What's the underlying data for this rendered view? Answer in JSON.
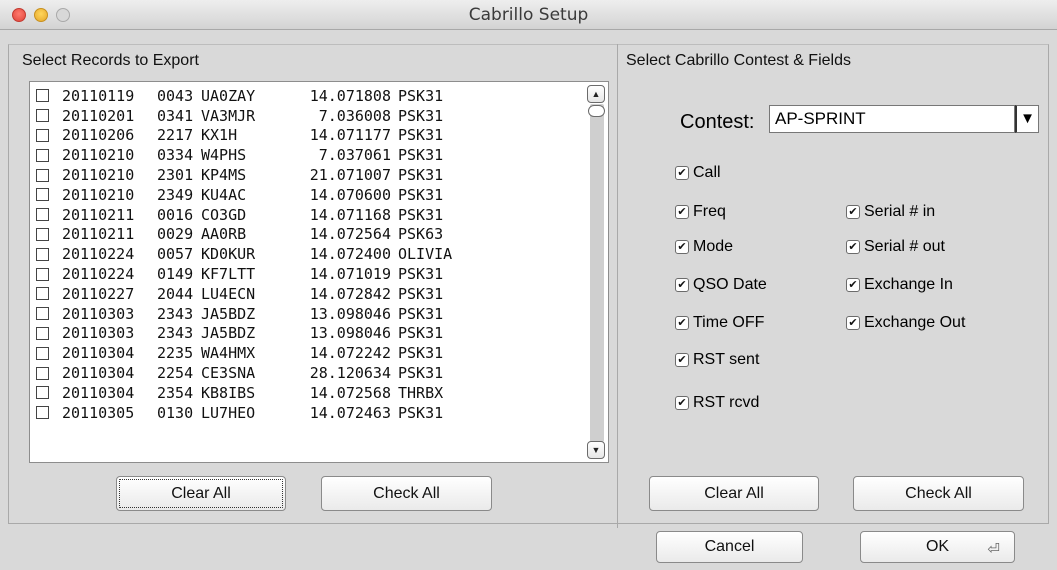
{
  "window": {
    "title": "Cabrillo Setup"
  },
  "left_panel": {
    "label": "Select Records to Export",
    "records": [
      {
        "date": "20110119",
        "time": "0043",
        "call": "UA0ZAY",
        "freq": "14.071808",
        "mode": "PSK31"
      },
      {
        "date": "20110201",
        "time": "0341",
        "call": "VA3MJR",
        "freq": "7.036008",
        "mode": "PSK31"
      },
      {
        "date": "20110206",
        "time": "2217",
        "call": "KX1H",
        "freq": "14.071177",
        "mode": "PSK31"
      },
      {
        "date": "20110210",
        "time": "0334",
        "call": "W4PHS",
        "freq": "7.037061",
        "mode": "PSK31"
      },
      {
        "date": "20110210",
        "time": "2301",
        "call": "KP4MS",
        "freq": "21.071007",
        "mode": "PSK31"
      },
      {
        "date": "20110210",
        "time": "2349",
        "call": "KU4AC",
        "freq": "14.070600",
        "mode": "PSK31"
      },
      {
        "date": "20110211",
        "time": "0016",
        "call": "CO3GD",
        "freq": "14.071168",
        "mode": "PSK31"
      },
      {
        "date": "20110211",
        "time": "0029",
        "call": "AA0RB",
        "freq": "14.072564",
        "mode": "PSK63"
      },
      {
        "date": "20110224",
        "time": "0057",
        "call": "KD0KUR",
        "freq": "14.072400",
        "mode": "OLIVIA"
      },
      {
        "date": "20110224",
        "time": "0149",
        "call": "KF7LTT",
        "freq": "14.071019",
        "mode": "PSK31"
      },
      {
        "date": "20110227",
        "time": "2044",
        "call": "LU4ECN",
        "freq": "14.072842",
        "mode": "PSK31"
      },
      {
        "date": "20110303",
        "time": "2343",
        "call": "JA5BDZ",
        "freq": "13.098046",
        "mode": "PSK31"
      },
      {
        "date": "20110303",
        "time": "2343",
        "call": "JA5BDZ",
        "freq": "13.098046",
        "mode": "PSK31"
      },
      {
        "date": "20110304",
        "time": "2235",
        "call": "WA4HMX",
        "freq": "14.072242",
        "mode": "PSK31"
      },
      {
        "date": "20110304",
        "time": "2254",
        "call": "CE3SNA",
        "freq": "28.120634",
        "mode": "PSK31"
      },
      {
        "date": "20110304",
        "time": "2354",
        "call": "KB8IBS",
        "freq": "14.072568",
        "mode": "THRBX"
      },
      {
        "date": "20110305",
        "time": "0130",
        "call": "LU7HEO",
        "freq": "14.072463",
        "mode": "PSK31"
      }
    ],
    "clear_all_label": "Clear All",
    "check_all_label": "Check All"
  },
  "right_panel": {
    "label": "Select Cabrillo Contest & Fields",
    "contest_label": "Contest:",
    "contest_value": "AP-SPRINT",
    "fields": {
      "call": "Call",
      "freq": "Freq",
      "mode": "Mode",
      "qso_date": "QSO Date",
      "time_off": "Time OFF",
      "rst_sent": "RST sent",
      "rst_rcvd": "RST rcvd",
      "serial_in": "Serial # in",
      "serial_out": "Serial # out",
      "exchange_in": "Exchange In",
      "exchange_out": "Exchange Out"
    },
    "clear_all_label": "Clear All",
    "check_all_label": "Check All"
  },
  "footer": {
    "cancel_label": "Cancel",
    "ok_label": "OK"
  }
}
